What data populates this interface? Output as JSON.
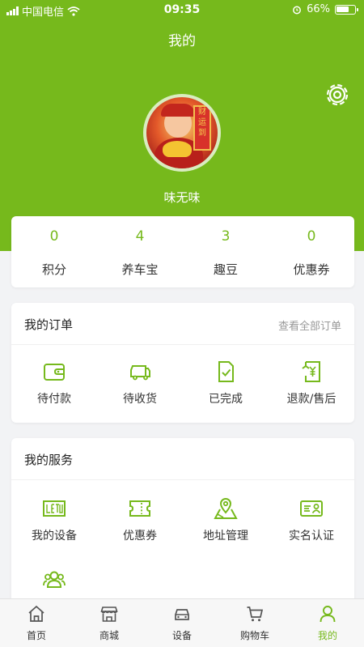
{
  "status_bar": {
    "carrier": "中国电信",
    "time": "09:35",
    "battery": "66%"
  },
  "header": {
    "title": "我的"
  },
  "profile": {
    "username": "味无味",
    "avatar_banner": "财运到"
  },
  "stats": [
    {
      "value": "0",
      "label": "积分"
    },
    {
      "value": "4",
      "label": "养车宝"
    },
    {
      "value": "3",
      "label": "趣豆"
    },
    {
      "value": "0",
      "label": "优惠券"
    }
  ],
  "orders": {
    "title": "我的订单",
    "view_all": "查看全部订单",
    "items": [
      {
        "label": "待付款",
        "icon": "wallet-icon"
      },
      {
        "label": "待收货",
        "icon": "truck-icon"
      },
      {
        "label": "已完成",
        "icon": "clipboard-check-icon"
      },
      {
        "label": "退款/售后",
        "icon": "refund-receipt-icon"
      }
    ]
  },
  "services": {
    "title": "我的服务",
    "items": [
      {
        "label": "我的设备",
        "icon": "device-display-icon"
      },
      {
        "label": "优惠券",
        "icon": "coupon-icon"
      },
      {
        "label": "地址管理",
        "icon": "map-pin-icon"
      },
      {
        "label": "实名认证",
        "icon": "id-card-icon"
      },
      {
        "label": "",
        "icon": "group-users-icon"
      }
    ]
  },
  "tabbar": [
    {
      "label": "首页",
      "icon": "home-icon"
    },
    {
      "label": "商城",
      "icon": "store-icon"
    },
    {
      "label": "设备",
      "icon": "car-icon"
    },
    {
      "label": "购物车",
      "icon": "cart-icon"
    },
    {
      "label": "我的",
      "icon": "user-icon",
      "active": true
    }
  ],
  "colors": {
    "accent": "#76b91c",
    "background": "#f2f3f5",
    "text": "#333333"
  }
}
